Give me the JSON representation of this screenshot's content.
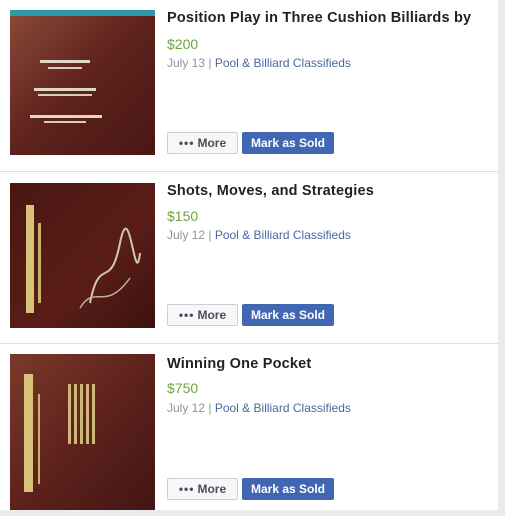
{
  "listings": [
    {
      "title": "Position Play in Three Cushion Billiards by",
      "price": "$200",
      "date": "July 13",
      "separator": " | ",
      "group": "Pool & Billiard Classifieds",
      "more_label": "More",
      "sold_label": "Mark as Sold",
      "thumb_icon": "book-cover-image"
    },
    {
      "title": "Shots, Moves, and Strategies",
      "price": "$150",
      "date": "July 12",
      "separator": " | ",
      "group": "Pool & Billiard Classifieds",
      "more_label": "More",
      "sold_label": "Mark as Sold",
      "thumb_icon": "book-cover-image"
    },
    {
      "title": "Winning One Pocket",
      "price": "$750",
      "date": "July 12",
      "separator": " | ",
      "group": "Pool & Billiard Classifieds",
      "more_label": "More",
      "sold_label": "Mark as Sold",
      "thumb_icon": "book-cover-image"
    }
  ],
  "colors": {
    "price": "#6fa33c",
    "link": "#4b67a1",
    "primary_button": "#4267b2"
  }
}
